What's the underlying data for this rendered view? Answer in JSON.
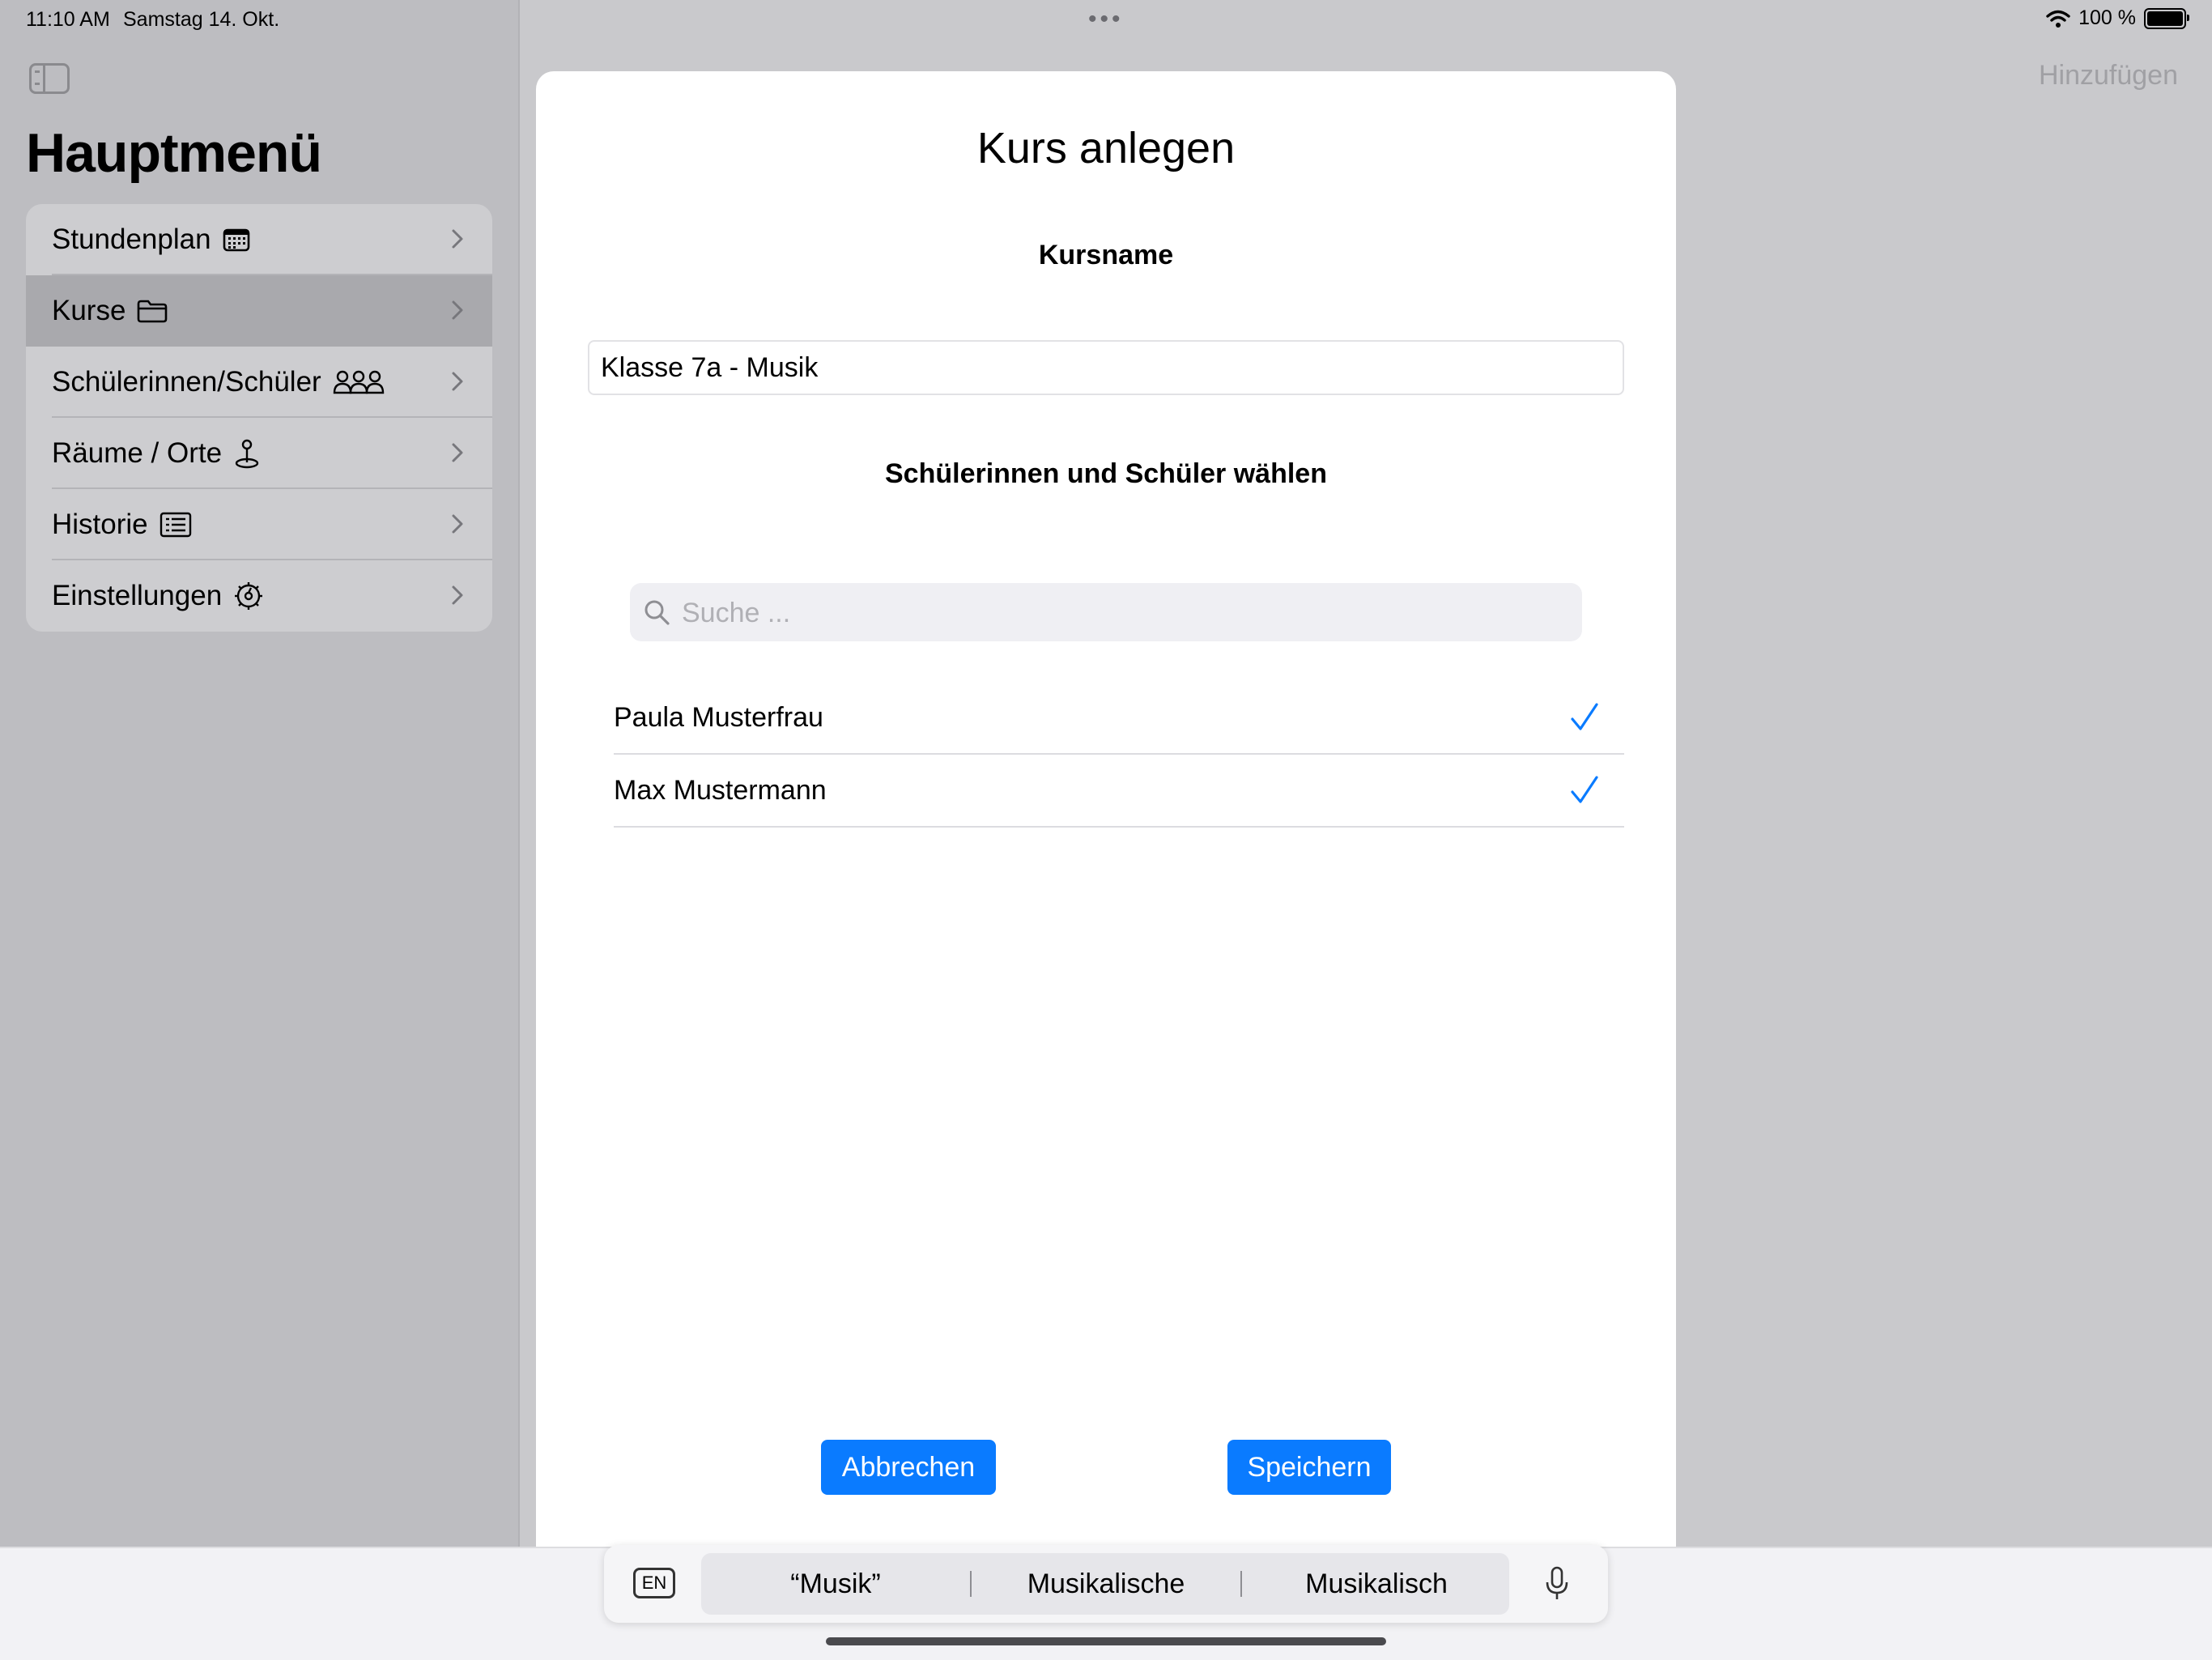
{
  "status_bar": {
    "time": "11:10 AM",
    "date": "Samstag 14. Okt.",
    "battery": "100 %",
    "battery_level": 1.0
  },
  "sidebar": {
    "title": "Hauptmenü",
    "selected_index": 1,
    "items": [
      {
        "label": "Stundenplan",
        "icon": "calendar-icon"
      },
      {
        "label": "Kurse",
        "icon": "folder-icon"
      },
      {
        "label": "Schülerinnen/Schüler",
        "icon": "people-icon"
      },
      {
        "label": "Räume / Orte",
        "icon": "location-pin-icon"
      },
      {
        "label": "Historie",
        "icon": "list-icon"
      },
      {
        "label": "Einstellungen",
        "icon": "gear-icon"
      }
    ]
  },
  "detail": {
    "add_label": "Hinzufügen"
  },
  "modal": {
    "title": "Kurs anlegen",
    "course_name_label": "Kursname",
    "course_name_value": "Klasse 7a - Musik",
    "students_label": "Schülerinnen und Schüler wählen",
    "search_placeholder": "Suche ...",
    "students": [
      {
        "name": "Paula Musterfrau",
        "selected": true
      },
      {
        "name": "Max Mustermann",
        "selected": true
      }
    ],
    "cancel_label": "Abbrechen",
    "save_label": "Speichern"
  },
  "keyboard_bar": {
    "language": "EN",
    "suggestions": [
      "“Musik”",
      "Musikalische",
      "Musikalisch"
    ]
  },
  "colors": {
    "accent": "#0a7bff",
    "sidebar_bg": "#bdbdc1",
    "dim_bg": "#c9c9cc"
  }
}
